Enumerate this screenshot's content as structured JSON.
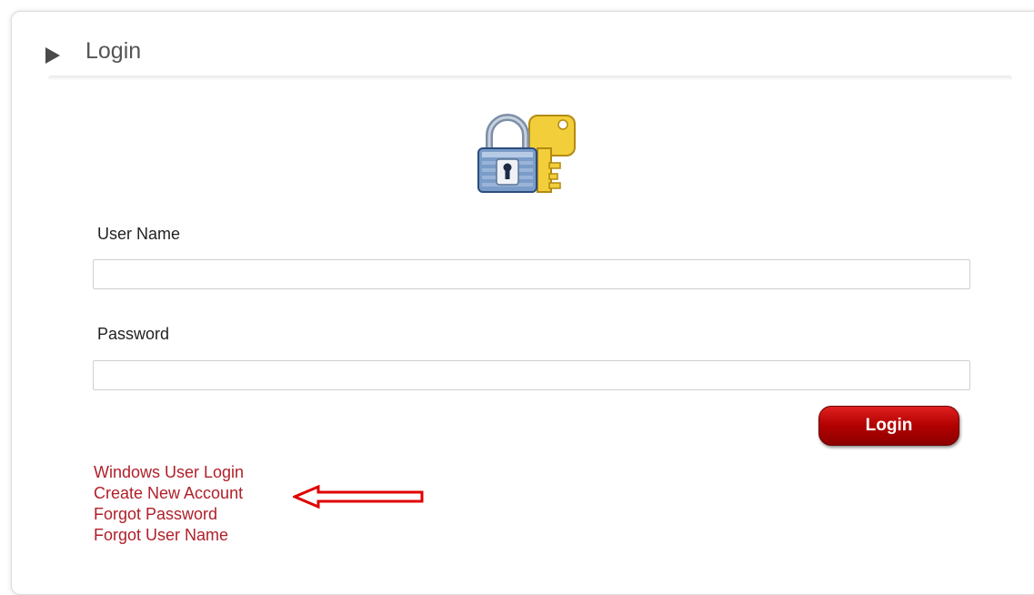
{
  "panel": {
    "title": "Login"
  },
  "form": {
    "username": {
      "label": "User Name",
      "value": "",
      "placeholder": ""
    },
    "password": {
      "label": "Password",
      "value": "",
      "placeholder": ""
    },
    "submit_label": "Login"
  },
  "links": [
    {
      "label": "Windows User Login"
    },
    {
      "label": "Create New Account"
    },
    {
      "label": "Forgot Password"
    },
    {
      "label": "Forgot User Name"
    }
  ],
  "icons": {
    "header": "triangle-right-icon",
    "hero": "lock-and-key-icon",
    "annotation": "red-arrow-icon"
  },
  "colors": {
    "link": "#b0202a",
    "button": "#b20000",
    "annotation_arrow": "#e00000"
  }
}
